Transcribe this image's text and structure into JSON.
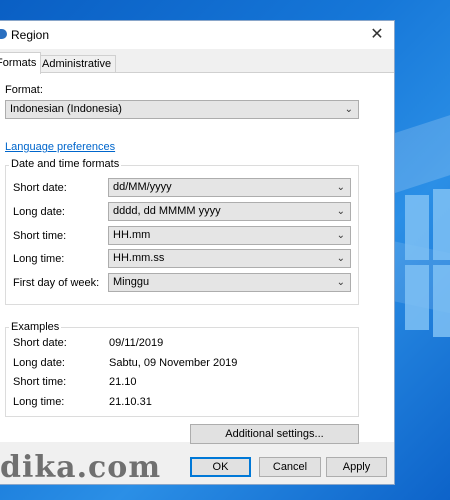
{
  "window": {
    "title": "Region",
    "close_label": "✕"
  },
  "tabs": [
    {
      "label": "Formats",
      "active": true
    },
    {
      "label": "Administrative",
      "active": false
    }
  ],
  "format": {
    "label": "Format:",
    "value": "Indonesian (Indonesia)"
  },
  "language_link": "Language preferences",
  "date_time": {
    "group_title": "Date and time formats",
    "rows": [
      {
        "label": "Short date:",
        "value": "dd/MM/yyyy"
      },
      {
        "label": "Long date:",
        "value": "dddd, dd MMMM yyyy"
      },
      {
        "label": "Short time:",
        "value": "HH.mm"
      },
      {
        "label": "Long time:",
        "value": "HH.mm.ss"
      },
      {
        "label": "First day of week:",
        "value": "Minggu"
      }
    ]
  },
  "examples": {
    "group_title": "Examples",
    "rows": [
      {
        "label": "Short date:",
        "value": "09/11/2019"
      },
      {
        "label": "Long date:",
        "value": "Sabtu, 09 November 2019"
      },
      {
        "label": "Short time:",
        "value": "21.10"
      },
      {
        "label": "Long time:",
        "value": "21.10.31"
      }
    ]
  },
  "buttons": {
    "additional": "Additional settings...",
    "ok": "OK",
    "cancel": "Cancel",
    "apply": "Apply"
  },
  "watermark": "dika.com",
  "icons": {
    "dropdown": "chevron-down-icon",
    "close": "close-icon",
    "app": "globe-icon"
  }
}
